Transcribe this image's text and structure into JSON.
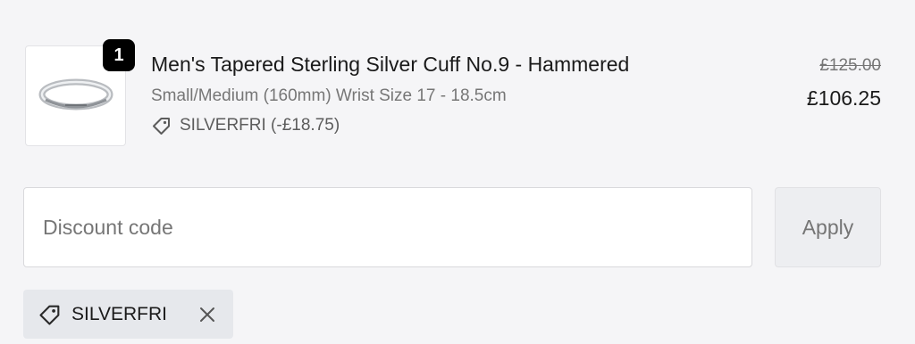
{
  "line_item": {
    "quantity": "1",
    "title": "Men's Tapered Sterling Silver Cuff No.9 - Hammered",
    "variant": "Small/Medium (160mm) Wrist Size 17 - 18.5cm",
    "discount": "SILVERFRI (-£18.75)",
    "original_price": "£125.00",
    "price": "£106.25"
  },
  "discount_form": {
    "placeholder": "Discount code",
    "value": "",
    "apply_label": "Apply"
  },
  "applied_discount": {
    "code": "SILVERFRI"
  }
}
